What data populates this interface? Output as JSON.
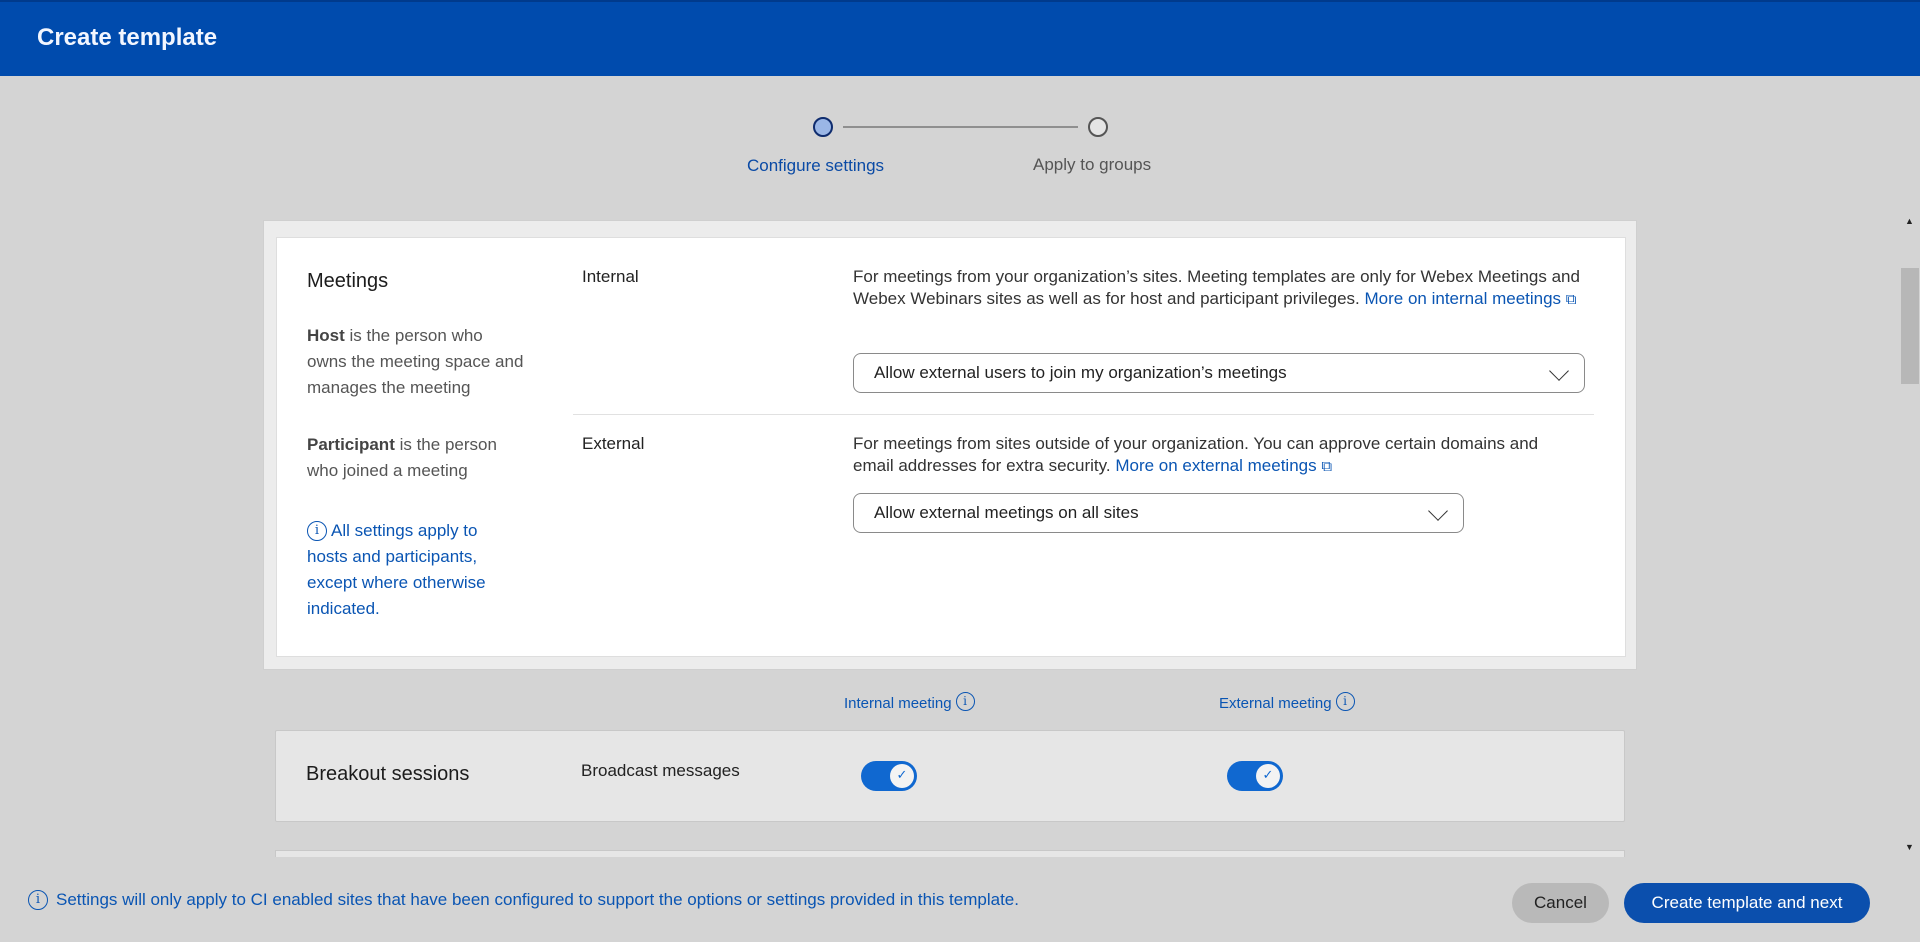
{
  "header": {
    "title": "Create template"
  },
  "stepper": {
    "steps": [
      {
        "label": "Configure settings",
        "active": true
      },
      {
        "label": "Apply to groups",
        "active": false
      }
    ]
  },
  "meetings": {
    "title": "Meetings",
    "host_term": "Host",
    "host_desc": " is the person who owns the meeting space and manages the meeting",
    "participant_term": "Participant",
    "participant_desc": " is the person who joined a meeting",
    "note": "All settings apply to hosts and participants, except where otherwise indicated.",
    "internal": {
      "label": "Internal",
      "description": "For meetings from your organization’s sites. Meeting templates are only for Webex Meetings and Webex Webinars sites as well as for host and participant privileges. ",
      "link": "More on internal meetings",
      "select_value": "Allow external users to join my organization’s meetings"
    },
    "external": {
      "label": "External",
      "description": "For meetings from sites outside of your organization. You can approve certain domains and email addresses for extra security. ",
      "link": "More on external meetings",
      "select_value": "Allow external meetings on all sites"
    }
  },
  "columns": {
    "internal": "Internal meeting",
    "external": "External meeting"
  },
  "breakout": {
    "title": "Breakout sessions",
    "setting_label": "Broadcast messages",
    "internal_enabled": true,
    "external_enabled": true
  },
  "footer": {
    "note": "Settings will only apply to CI enabled sites that have been configured to support the options or settings provided in this template.",
    "cancel_label": "Cancel",
    "primary_label": "Create template and next"
  },
  "colors": {
    "brand": "#004bad",
    "link": "#0a55b3",
    "toggle_on": "#1068d0"
  }
}
